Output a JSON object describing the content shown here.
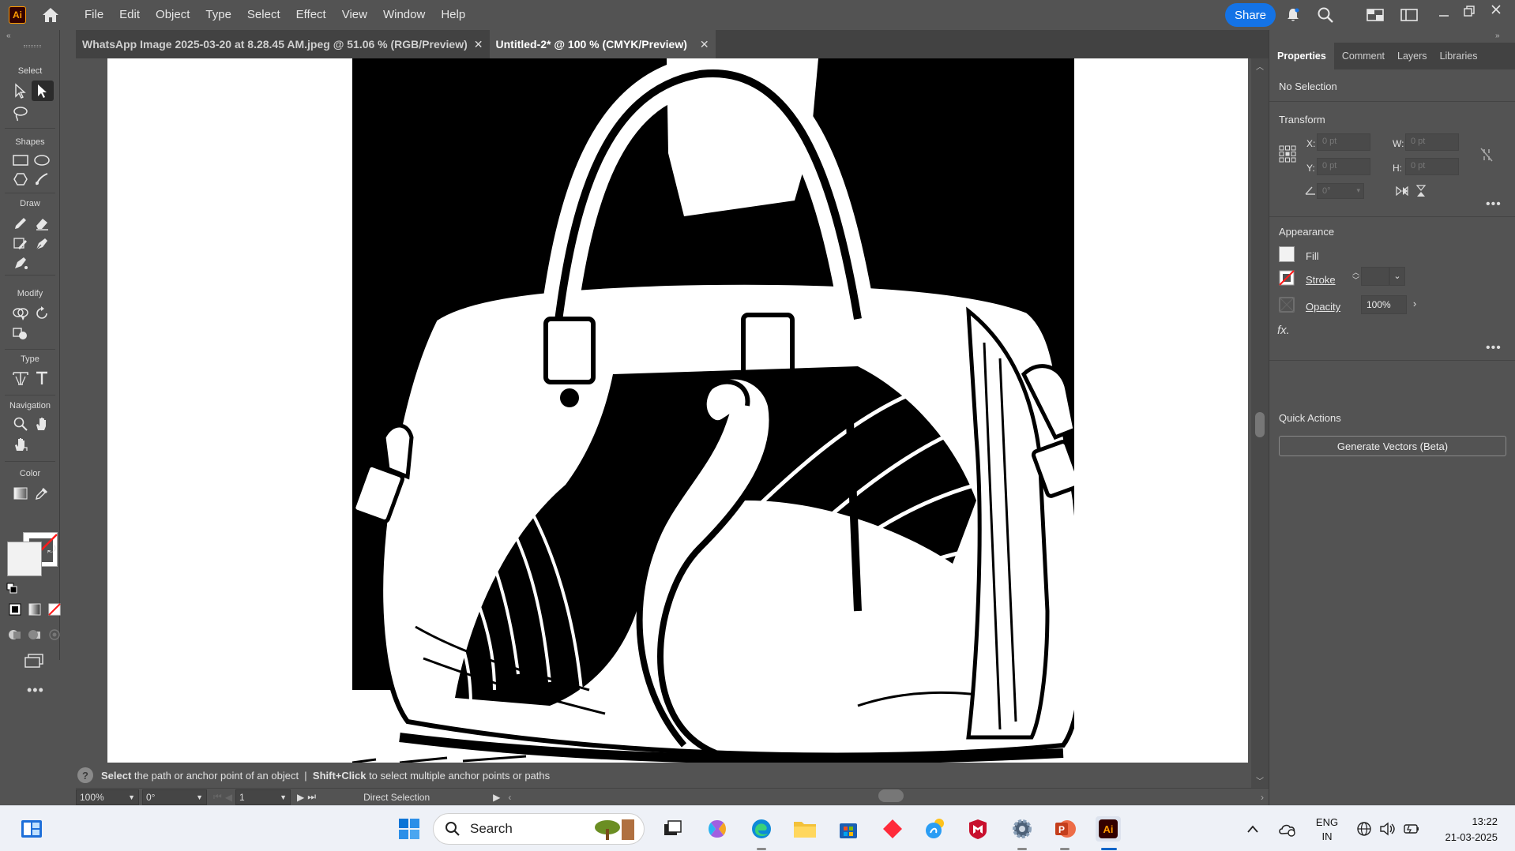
{
  "app": {
    "logo_text": "Ai",
    "menu": [
      "File",
      "Edit",
      "Object",
      "Type",
      "Select",
      "Effect",
      "View",
      "Window",
      "Help"
    ],
    "share_label": "Share"
  },
  "tabs": [
    {
      "label": "WhatsApp Image 2025-03-20 at 8.28.45 AM.jpeg @ 51.06 % (RGB/Preview)",
      "active": false
    },
    {
      "label": "Untitled-2* @ 100 % (CMYK/Preview)",
      "active": true
    }
  ],
  "toolbar": {
    "sections": {
      "select": "Select",
      "shapes": "Shapes",
      "draw": "Draw",
      "modify": "Modify",
      "type": "Type",
      "navigation": "Navigation",
      "color": "Color"
    }
  },
  "status": {
    "hint_bold_1": "Select",
    "hint_text_1": " the path or anchor point of an object  |  ",
    "hint_bold_2": "Shift+Click",
    "hint_text_2": " to select multiple anchor points or paths",
    "zoom": "100%",
    "rotation": "0°",
    "artboard": "1",
    "tool": "Direct Selection"
  },
  "panel": {
    "tabs": [
      "Properties",
      "Comment",
      "Layers",
      "Libraries"
    ],
    "selection": "No Selection",
    "transform": {
      "title": "Transform",
      "x_label": "X:",
      "x_value": "0 pt",
      "y_label": "Y:",
      "y_value": "0 pt",
      "w_label": "W:",
      "w_value": "0 pt",
      "h_label": "H:",
      "h_value": "0 pt",
      "angle_value": "0°"
    },
    "appearance": {
      "title": "Appearance",
      "fill": "Fill",
      "stroke": "Stroke",
      "opacity": "Opacity",
      "opacity_value": "100%",
      "fx": "fx."
    },
    "quick_actions": {
      "title": "Quick Actions",
      "button": "Generate Vectors (Beta)"
    }
  },
  "taskbar": {
    "search_placeholder": "Search",
    "lang_1": "ENG",
    "lang_2": "IN",
    "time": "13:22",
    "date": "21-03-2025"
  },
  "colors": {
    "accent": "#1473e6",
    "ai_orange": "#ff9a00",
    "ui_bg": "#535353"
  }
}
